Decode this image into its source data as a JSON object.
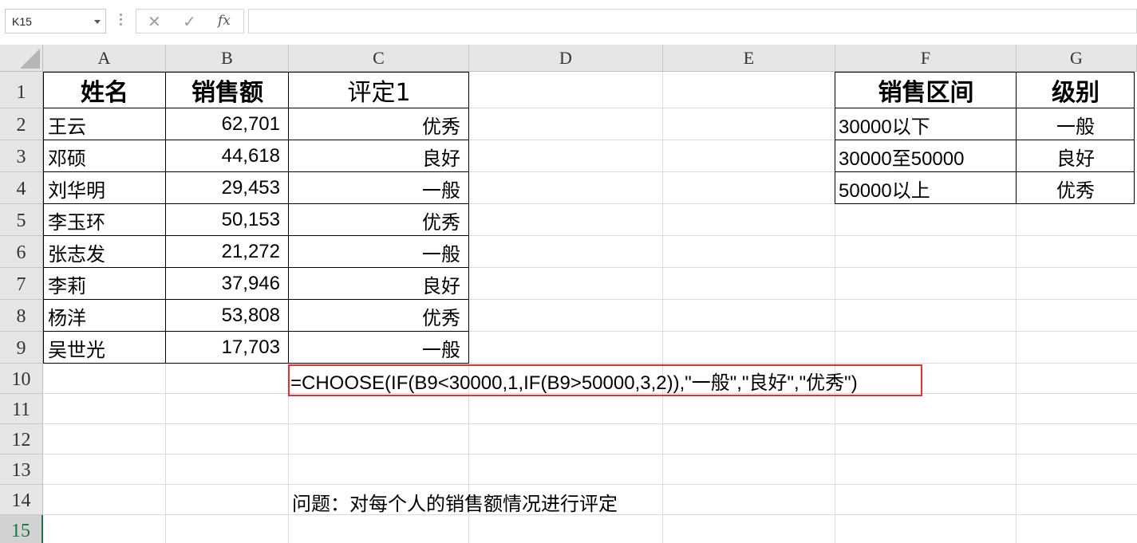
{
  "formula_bar": {
    "name_box": "K15",
    "fx_label": "fx",
    "formula": ""
  },
  "columns": [
    "A",
    "B",
    "C",
    "D",
    "E",
    "F",
    "G"
  ],
  "rows": [
    "1",
    "2",
    "3",
    "4",
    "5",
    "6",
    "7",
    "8",
    "9",
    "10",
    "11",
    "12",
    "13",
    "14",
    "15"
  ],
  "sales_table": {
    "headers": [
      "姓名",
      "销售额",
      "评定1"
    ],
    "rows": [
      {
        "name": "王云",
        "sales": "62,701",
        "rating": "优秀"
      },
      {
        "name": "邓硕",
        "sales": "44,618",
        "rating": "良好"
      },
      {
        "name": "刘华明",
        "sales": "29,453",
        "rating": "一般"
      },
      {
        "name": "李玉环",
        "sales": "50,153",
        "rating": "优秀"
      },
      {
        "name": "张志发",
        "sales": "21,272",
        "rating": "一般"
      },
      {
        "name": "李莉",
        "sales": "37,946",
        "rating": "良好"
      },
      {
        "name": "杨洋",
        "sales": "53,808",
        "rating": "优秀"
      },
      {
        "name": "吴世光",
        "sales": "17,703",
        "rating": "一般"
      }
    ]
  },
  "level_table": {
    "headers": [
      "销售区间",
      "级别"
    ],
    "rows": [
      {
        "range": "30000以下",
        "level": "一般"
      },
      {
        "range": "30000至50000",
        "level": "良好"
      },
      {
        "range": "50000以上",
        "level": "优秀"
      }
    ]
  },
  "formula_note": "=CHOOSE(IF(B9<30000,1,IF(B9>50000,3,2)),\"一般\",\"良好\",\"优秀\")",
  "question": "问题：对每个人的销售额情况进行评定",
  "colors": {
    "header_bg": "#e6e6e6",
    "selected_row_accent": "#217346",
    "highlight_box": "#e0332f",
    "gridline": "#dadada"
  }
}
